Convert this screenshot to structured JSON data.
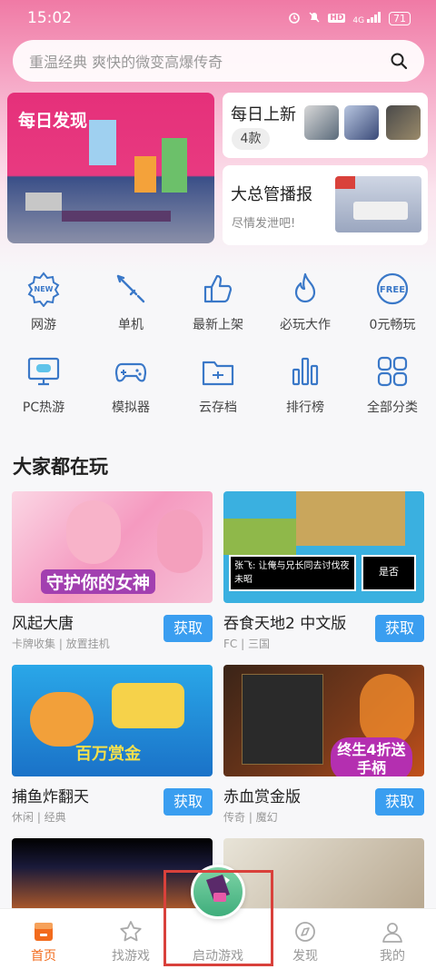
{
  "status": {
    "time": "15:02",
    "hd": "HD",
    "network": "4G",
    "battery": "71"
  },
  "search": {
    "placeholder": "重温经典 爽快的微变高爆传奇"
  },
  "banners": {
    "daily_discover": "每日发现",
    "daily_new": {
      "title": "每日上新",
      "count": "4款"
    },
    "manager_report": {
      "title": "大总管播报",
      "subtitle": "尽情发泄吧!"
    }
  },
  "categories": [
    {
      "label": "网游",
      "icon": "new-badge-icon"
    },
    {
      "label": "单机",
      "icon": "sword-icon"
    },
    {
      "label": "最新上架",
      "icon": "thumbs-up-icon"
    },
    {
      "label": "必玩大作",
      "icon": "flame-icon"
    },
    {
      "label": "0元畅玩",
      "icon": "free-badge-icon"
    },
    {
      "label": "PC热游",
      "icon": "monitor-gamepad-icon"
    },
    {
      "label": "模拟器",
      "icon": "gamepad-icon"
    },
    {
      "label": "云存档",
      "icon": "cloud-folder-icon"
    },
    {
      "label": "排行榜",
      "icon": "bar-chart-icon"
    },
    {
      "label": "全部分类",
      "icon": "grid-icon"
    }
  ],
  "section": {
    "title": "大家都在玩"
  },
  "games": [
    {
      "name": "风起大唐",
      "tags": "卡牌收集 | 放置挂机",
      "button": "获取",
      "banner_text": "守护你的女神"
    },
    {
      "name": "吞食天地2 中文版",
      "tags": "FC | 三国",
      "button": "获取",
      "dialog_text": "张飞: 让俺与兄长同去讨伐夜未昭",
      "dialog_right": "是否"
    },
    {
      "name": "捕鱼炸翻天",
      "tags": "休闲 | 经典",
      "button": "获取",
      "banner_text": "百万赏金"
    },
    {
      "name": "赤血赏金版",
      "tags": "传奇 | 魔幻",
      "button": "获取",
      "banner_text": "终生4折送手柄"
    }
  ],
  "tabs": [
    {
      "label": "首页",
      "icon": "home-icon",
      "active": true
    },
    {
      "label": "找游戏",
      "icon": "star-icon"
    },
    {
      "label": "启动游戏",
      "icon": "launch-icon"
    },
    {
      "label": "发现",
      "icon": "compass-icon"
    },
    {
      "label": "我的",
      "icon": "user-icon"
    }
  ],
  "colors": {
    "accent": "#3a9ef0",
    "active_tab": "#f26b1d",
    "header_pink": "#f07aa5",
    "highlight": "#d9413b"
  }
}
